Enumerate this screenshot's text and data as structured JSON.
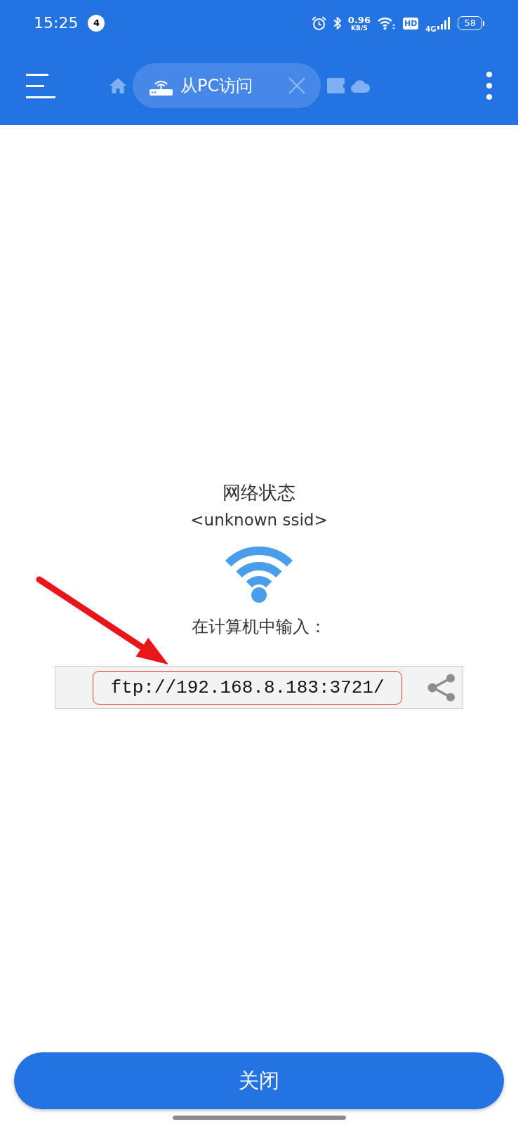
{
  "status_bar": {
    "time": "15:25",
    "notification_count": "4",
    "speed": "0.96",
    "speed_unit": "KB/S",
    "hd": "HD",
    "network_type": "4G",
    "battery": "58"
  },
  "toolbar": {
    "tabs": [
      {
        "selected": false
      },
      {
        "label": "从PC访问",
        "selected": true
      },
      {
        "selected": false
      },
      {
        "selected": false
      }
    ]
  },
  "content": {
    "title": "网络状态",
    "ssid": "<unknown ssid>",
    "instruction": "在计算机中输入：",
    "address": {
      "text": "ftp://192.168.8.183:3721/",
      "highlighted": true
    }
  },
  "close_button": "关闭"
}
